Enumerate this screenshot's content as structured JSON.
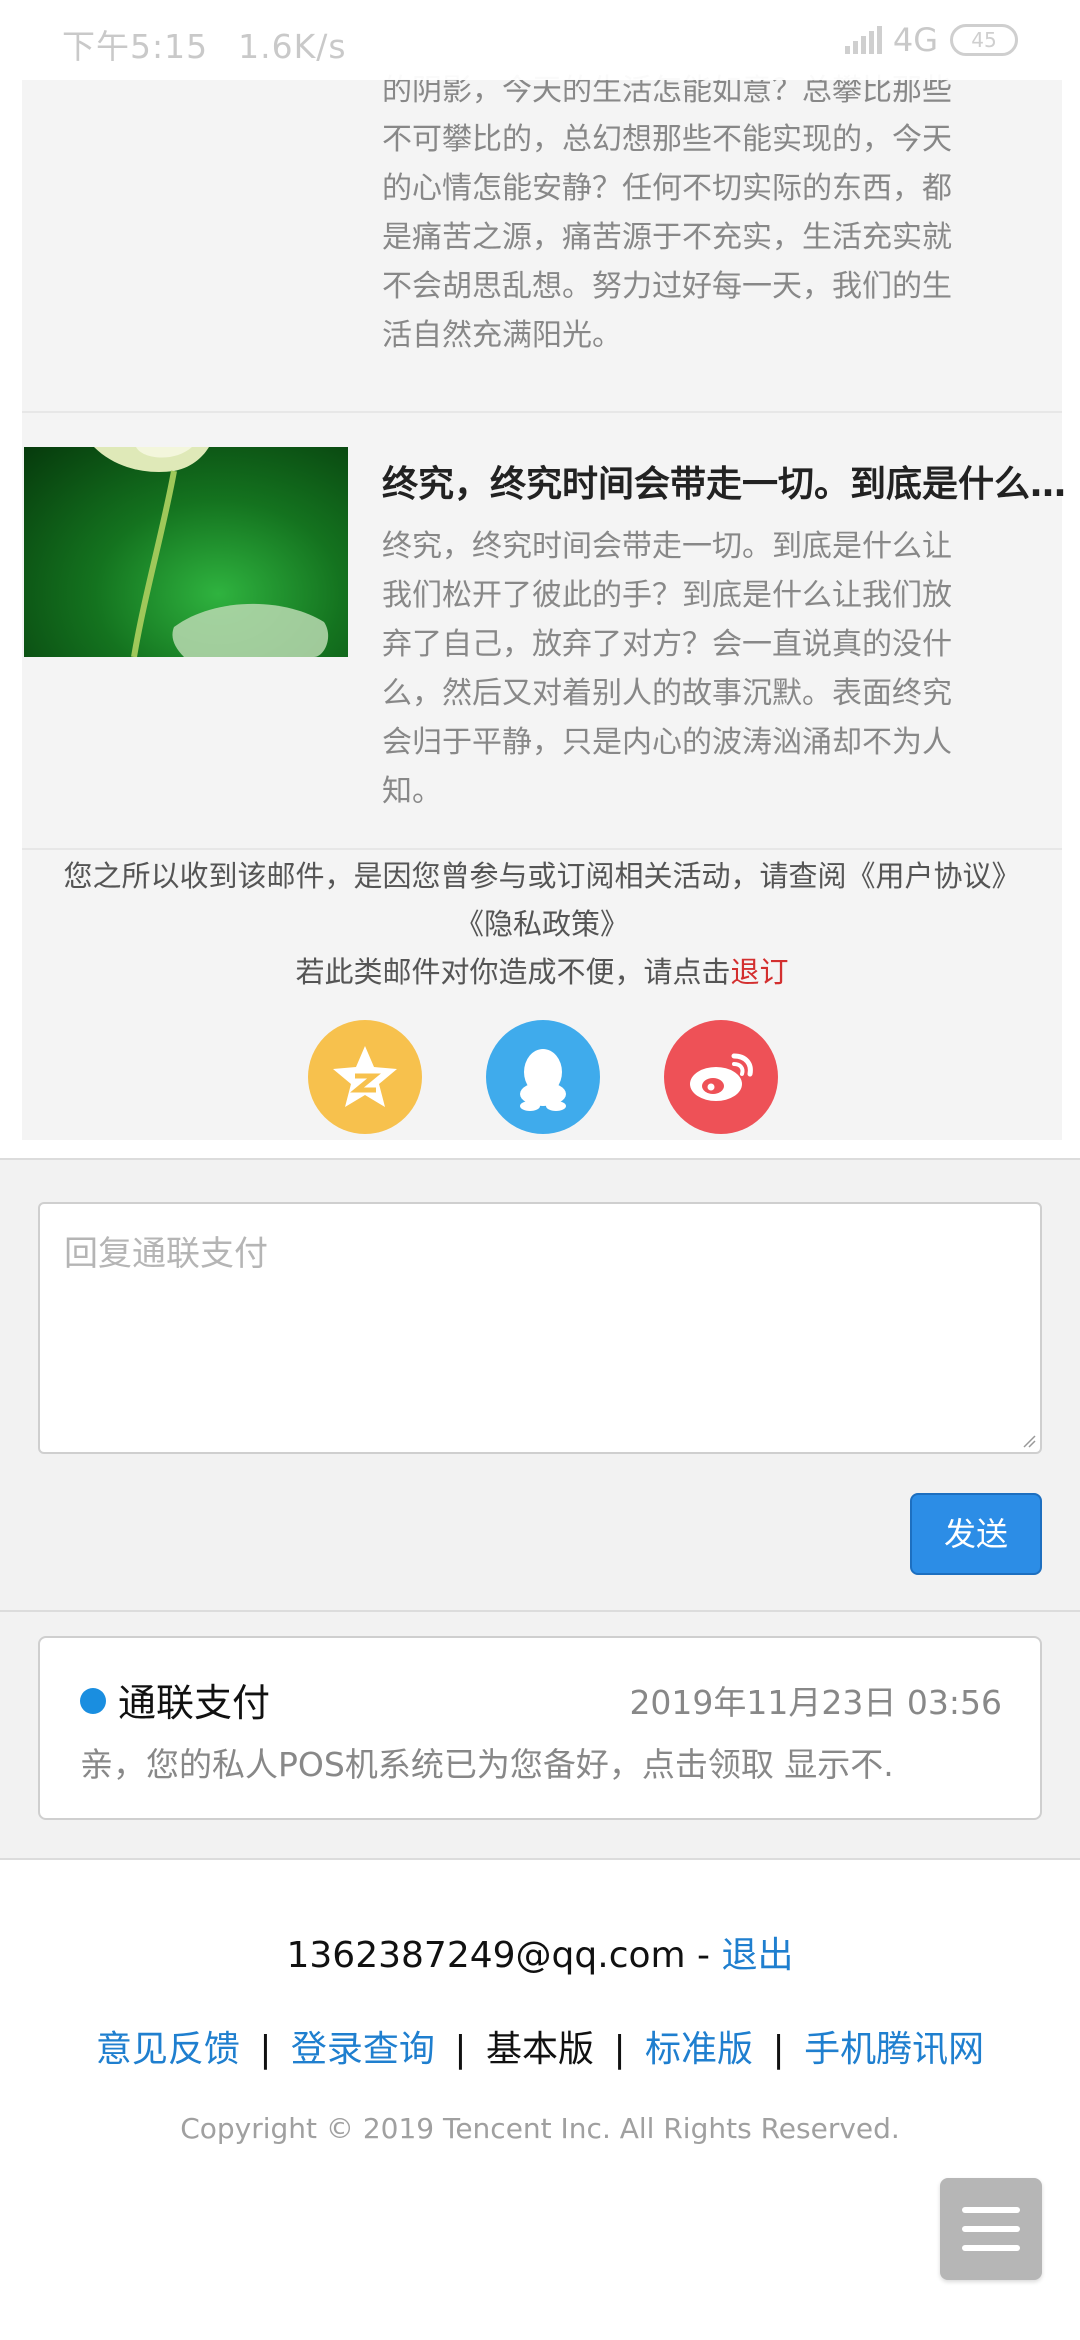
{
  "status_bar": {
    "time": "下午5:15",
    "speed": "1.6K/s",
    "network": "4G",
    "battery": "45"
  },
  "email": {
    "article1": {
      "text_lines": [
        "的阴影，今天的生活怎能如意？总攀比那些",
        "不可攀比的，总幻想那些不能实现的，今天",
        "的心情怎能安静？任何不切实际的东西，都",
        "是痛苦之源，痛苦源于不充实，生活充实就",
        "不会胡思乱想。努力过好每一天，我们的生",
        "活自然充满阳光。"
      ]
    },
    "article2": {
      "title": "终究，终究时间会带走一切。到底是什么让我们松开了彼此的手？",
      "text_lines": [
        "终究，终究时间会带走一切。到底是什么让",
        "我们松开了彼此的手？到底是什么让我们放",
        "弃了自己，放弃了对方？会一直说真的没什",
        "么，然后又对着别人的故事沉默。表面终究",
        "会归于平静，只是内心的波涛汹涌却不为人",
        "知。"
      ]
    },
    "notice": {
      "line1": "您之所以收到该邮件，是因您曾参与或订阅相关活动，请查阅《用户协议》",
      "line2": "《隐私政策》",
      "line3_prefix": "若此类邮件对你造成不便，请点击",
      "unsubscribe_label": "退订"
    },
    "socials": [
      "qzone-icon",
      "qq-icon",
      "weibo-icon"
    ],
    "colors": {
      "qzone": "#f7c14d",
      "qq": "#3fabec",
      "weibo": "#ee5157"
    }
  },
  "reply": {
    "placeholder": "回复通联支付",
    "send_label": "发送"
  },
  "summary": {
    "sender": "通联支付",
    "date": "2019年11月23日 03:56",
    "preview": "亲，您的私人POS机系统已为您备好，点击领取 显示不."
  },
  "footer": {
    "account": "1362387249@qq.com",
    "account_sep": " - ",
    "logout_label": "退出",
    "links": {
      "feedback": "意见反馈",
      "login_query": "登录查询",
      "basic": "基本版",
      "standard": "标准版",
      "mobile": "手机腾讯网"
    },
    "separator": "|",
    "copyright": "Copyright © 2019 Tencent Inc. All Rights Reserved."
  },
  "menu_icon": "hamburger-icon",
  "accent_color": "#2c8de6"
}
